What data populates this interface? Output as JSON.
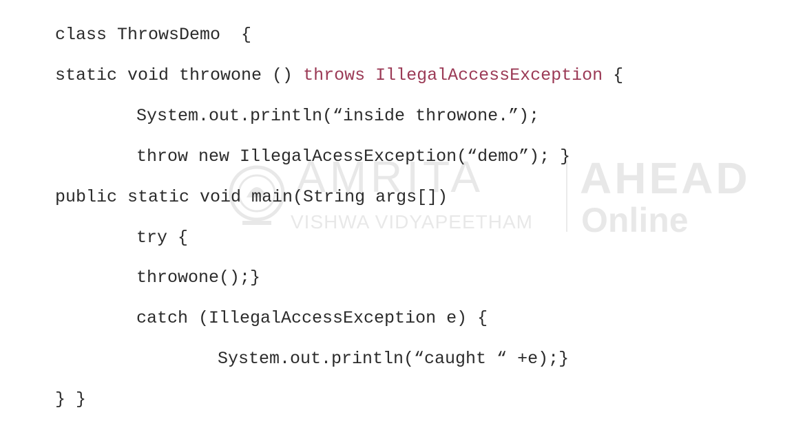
{
  "code": {
    "line1": "class ThrowsDemo  {",
    "line2_pre": "static void throwone () ",
    "line2_kw": "throws IllegalAccessException",
    "line2_post": " {",
    "line3": "System.out.println(“inside throwone.”);",
    "line4": "throw new IllegalAcessException(“demo”); }",
    "line5": "public static void main(String args[])",
    "line6": "try {",
    "line7": "throwone();}",
    "line8": "catch (IllegalAccessException e) {",
    "line9": "System.out.println(“caught “ +e);}",
    "line10": "} }"
  },
  "watermark": {
    "brand": "AMRITA",
    "subtitle": "VISHWA VIDYAPEETHAM",
    "product_top": "AHEAD",
    "product_bottom": "Online"
  },
  "colors": {
    "text": "#2b2b2b",
    "keyword": "#9b3a56",
    "background": "#ffffff"
  }
}
